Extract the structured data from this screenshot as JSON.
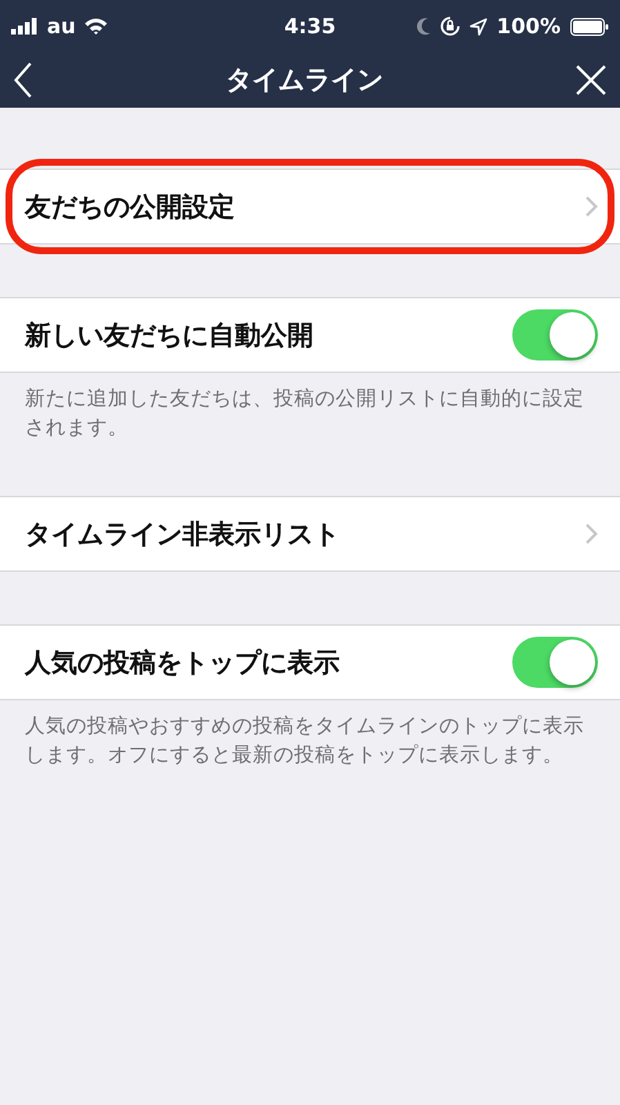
{
  "status_bar": {
    "carrier": "au",
    "time": "4:35",
    "battery": "100%"
  },
  "nav_bar": {
    "title": "タイムライン"
  },
  "sections": [
    {
      "rows": [
        {
          "kind": "link",
          "label": "友だちの公開設定",
          "highlighted": true
        }
      ]
    },
    {
      "rows": [
        {
          "kind": "toggle",
          "label": "新しい友だちに自動公開",
          "on": true
        }
      ],
      "footer": "新たに追加した友だちは、投稿の公開リストに自動的に設定されます。"
    },
    {
      "rows": [
        {
          "kind": "link",
          "label": "タイムライン非表示リスト",
          "highlighted": false
        }
      ]
    },
    {
      "rows": [
        {
          "kind": "toggle",
          "label": "人気の投稿をトップに表示",
          "on": true
        }
      ],
      "footer": "人気の投稿やおすすめの投稿をタイムラインのトップに表示します。オフにすると最新の投稿をトップに表示します。"
    }
  ]
}
